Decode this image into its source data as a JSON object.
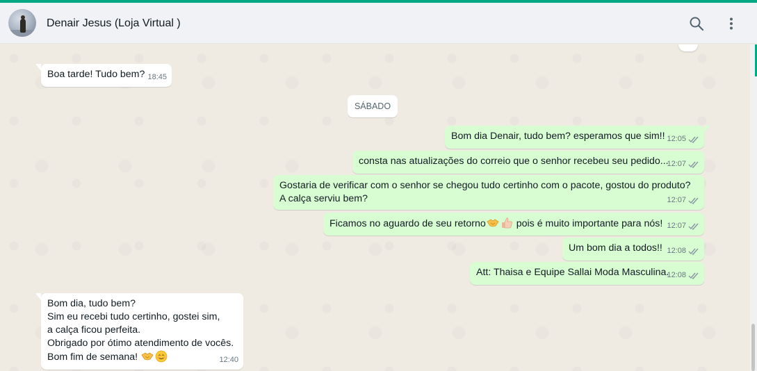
{
  "header": {
    "contact_name": "Denair Jesus (Loja Virtual )"
  },
  "icons": {
    "search": "search-icon",
    "menu": "kebab-menu-icon",
    "ticks": "double-check-icon",
    "handshake": "handshake-emoji",
    "thumbs_up": "thumbs-up-emoji",
    "smile": "smiling-face-emoji"
  },
  "colors": {
    "accent": "#00a884",
    "outgoing_bubble": "#d9fdd3",
    "incoming_bubble": "#ffffff",
    "chat_background": "#efeae2"
  },
  "day_separator": "SÁBADO",
  "messages": [
    {
      "direction": "in",
      "text": "Boa tarde! Tudo bem?",
      "time": "18:45"
    },
    {
      "direction": "out",
      "text": "Bom dia Denair, tudo bem? esperamos que sim!!",
      "time": "12:05"
    },
    {
      "direction": "out",
      "text": "consta nas atualizações do correio que o senhor recebeu seu pedido...",
      "time": "12:07"
    },
    {
      "direction": "out",
      "text": "Gostaria de verificar com o senhor se chegou tudo certinho com o pacote, gostou do produto?\nA calça serviu bem?",
      "time": "12:07"
    },
    {
      "direction": "out",
      "text_before": "Ficamos no aguardo de seu retorno",
      "text_after": " pois é muito importante para nós!",
      "time": "12:07"
    },
    {
      "direction": "out",
      "text": "Um bom dia a todos!!",
      "time": "12:08"
    },
    {
      "direction": "out",
      "text": "Att: Thaisa e Equipe Sallai Moda Masculina.",
      "time": "12:08"
    },
    {
      "direction": "in",
      "text": "Bom dia, tudo bem?\nSim eu recebi tudo certinho, gostei sim,\na calça ficou perfeita.\nObrigado por  ótimo atendimento de vocês.\nBom fim de semana! ",
      "time": "12:40"
    }
  ]
}
